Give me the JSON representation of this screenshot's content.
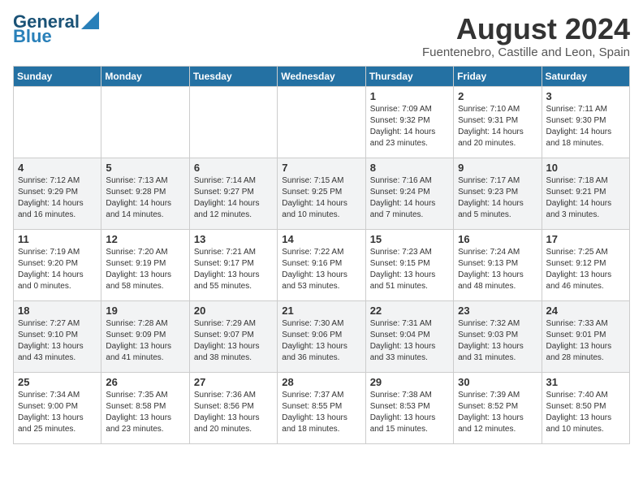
{
  "header": {
    "logo_line1": "General",
    "logo_line2": "Blue",
    "month_year": "August 2024",
    "location": "Fuentenebro, Castille and Leon, Spain"
  },
  "days_of_week": [
    "Sunday",
    "Monday",
    "Tuesday",
    "Wednesday",
    "Thursday",
    "Friday",
    "Saturday"
  ],
  "weeks": [
    [
      {
        "day": "",
        "content": ""
      },
      {
        "day": "",
        "content": ""
      },
      {
        "day": "",
        "content": ""
      },
      {
        "day": "",
        "content": ""
      },
      {
        "day": "1",
        "content": "Sunrise: 7:09 AM\nSunset: 9:32 PM\nDaylight: 14 hours\nand 23 minutes."
      },
      {
        "day": "2",
        "content": "Sunrise: 7:10 AM\nSunset: 9:31 PM\nDaylight: 14 hours\nand 20 minutes."
      },
      {
        "day": "3",
        "content": "Sunrise: 7:11 AM\nSunset: 9:30 PM\nDaylight: 14 hours\nand 18 minutes."
      }
    ],
    [
      {
        "day": "4",
        "content": "Sunrise: 7:12 AM\nSunset: 9:29 PM\nDaylight: 14 hours\nand 16 minutes."
      },
      {
        "day": "5",
        "content": "Sunrise: 7:13 AM\nSunset: 9:28 PM\nDaylight: 14 hours\nand 14 minutes."
      },
      {
        "day": "6",
        "content": "Sunrise: 7:14 AM\nSunset: 9:27 PM\nDaylight: 14 hours\nand 12 minutes."
      },
      {
        "day": "7",
        "content": "Sunrise: 7:15 AM\nSunset: 9:25 PM\nDaylight: 14 hours\nand 10 minutes."
      },
      {
        "day": "8",
        "content": "Sunrise: 7:16 AM\nSunset: 9:24 PM\nDaylight: 14 hours\nand 7 minutes."
      },
      {
        "day": "9",
        "content": "Sunrise: 7:17 AM\nSunset: 9:23 PM\nDaylight: 14 hours\nand 5 minutes."
      },
      {
        "day": "10",
        "content": "Sunrise: 7:18 AM\nSunset: 9:21 PM\nDaylight: 14 hours\nand 3 minutes."
      }
    ],
    [
      {
        "day": "11",
        "content": "Sunrise: 7:19 AM\nSunset: 9:20 PM\nDaylight: 14 hours\nand 0 minutes."
      },
      {
        "day": "12",
        "content": "Sunrise: 7:20 AM\nSunset: 9:19 PM\nDaylight: 13 hours\nand 58 minutes."
      },
      {
        "day": "13",
        "content": "Sunrise: 7:21 AM\nSunset: 9:17 PM\nDaylight: 13 hours\nand 55 minutes."
      },
      {
        "day": "14",
        "content": "Sunrise: 7:22 AM\nSunset: 9:16 PM\nDaylight: 13 hours\nand 53 minutes."
      },
      {
        "day": "15",
        "content": "Sunrise: 7:23 AM\nSunset: 9:15 PM\nDaylight: 13 hours\nand 51 minutes."
      },
      {
        "day": "16",
        "content": "Sunrise: 7:24 AM\nSunset: 9:13 PM\nDaylight: 13 hours\nand 48 minutes."
      },
      {
        "day": "17",
        "content": "Sunrise: 7:25 AM\nSunset: 9:12 PM\nDaylight: 13 hours\nand 46 minutes."
      }
    ],
    [
      {
        "day": "18",
        "content": "Sunrise: 7:27 AM\nSunset: 9:10 PM\nDaylight: 13 hours\nand 43 minutes."
      },
      {
        "day": "19",
        "content": "Sunrise: 7:28 AM\nSunset: 9:09 PM\nDaylight: 13 hours\nand 41 minutes."
      },
      {
        "day": "20",
        "content": "Sunrise: 7:29 AM\nSunset: 9:07 PM\nDaylight: 13 hours\nand 38 minutes."
      },
      {
        "day": "21",
        "content": "Sunrise: 7:30 AM\nSunset: 9:06 PM\nDaylight: 13 hours\nand 36 minutes."
      },
      {
        "day": "22",
        "content": "Sunrise: 7:31 AM\nSunset: 9:04 PM\nDaylight: 13 hours\nand 33 minutes."
      },
      {
        "day": "23",
        "content": "Sunrise: 7:32 AM\nSunset: 9:03 PM\nDaylight: 13 hours\nand 31 minutes."
      },
      {
        "day": "24",
        "content": "Sunrise: 7:33 AM\nSunset: 9:01 PM\nDaylight: 13 hours\nand 28 minutes."
      }
    ],
    [
      {
        "day": "25",
        "content": "Sunrise: 7:34 AM\nSunset: 9:00 PM\nDaylight: 13 hours\nand 25 minutes."
      },
      {
        "day": "26",
        "content": "Sunrise: 7:35 AM\nSunset: 8:58 PM\nDaylight: 13 hours\nand 23 minutes."
      },
      {
        "day": "27",
        "content": "Sunrise: 7:36 AM\nSunset: 8:56 PM\nDaylight: 13 hours\nand 20 minutes."
      },
      {
        "day": "28",
        "content": "Sunrise: 7:37 AM\nSunset: 8:55 PM\nDaylight: 13 hours\nand 18 minutes."
      },
      {
        "day": "29",
        "content": "Sunrise: 7:38 AM\nSunset: 8:53 PM\nDaylight: 13 hours\nand 15 minutes."
      },
      {
        "day": "30",
        "content": "Sunrise: 7:39 AM\nSunset: 8:52 PM\nDaylight: 13 hours\nand 12 minutes."
      },
      {
        "day": "31",
        "content": "Sunrise: 7:40 AM\nSunset: 8:50 PM\nDaylight: 13 hours\nand 10 minutes."
      }
    ]
  ]
}
